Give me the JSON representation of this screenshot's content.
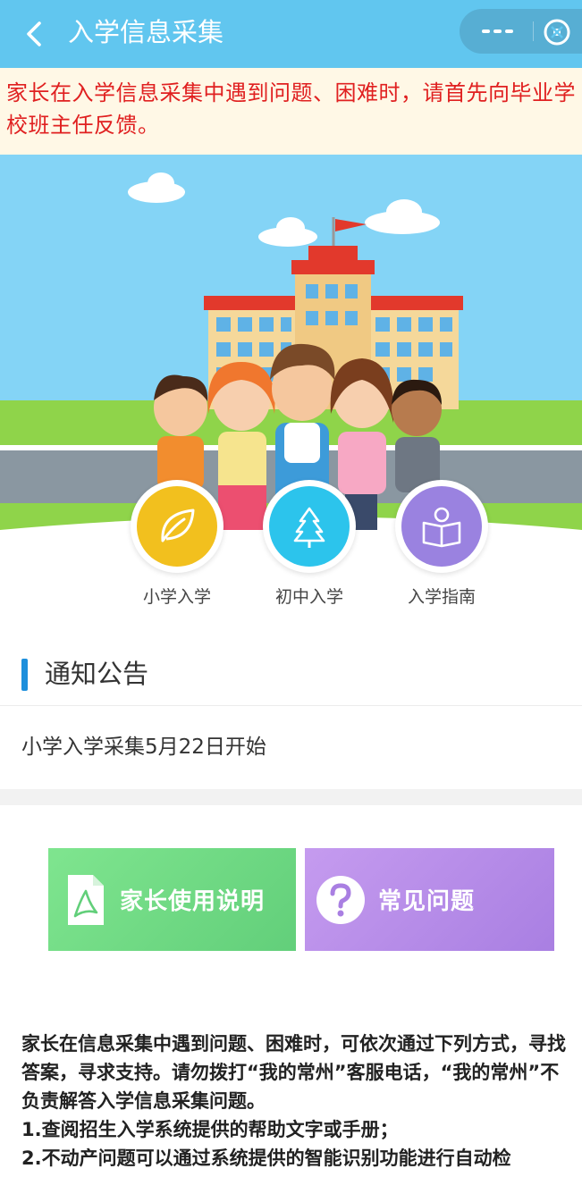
{
  "header": {
    "title": "入学信息采集"
  },
  "warning": {
    "text": "家长在入学信息采集中遇到问题、困难时，请首先向毕业学校班主任反馈。"
  },
  "entries": [
    {
      "label": "小学入学",
      "icon": "leaf-icon",
      "color": "#f2c01e"
    },
    {
      "label": "初中入学",
      "icon": "tree-icon",
      "color": "#2cc4ec"
    },
    {
      "label": "入学指南",
      "icon": "reading-icon",
      "color": "#9a82e0"
    }
  ],
  "notice": {
    "title": "通知公告",
    "items": [
      "小学入学采集5月22日开始"
    ]
  },
  "cards": {
    "guide_label": "家长使用说明",
    "faq_label": "常见问题"
  },
  "help": {
    "lines": [
      "家长在信息采集中遇到问题、困难时，可依次通过下列方式，寻找答案，寻求支持。请勿拨打“我的常州”客服电话，“我的常州”不负责解答入学信息采集问题。",
      "1.查阅招生入学系统提供的帮助文字或手册；",
      "2.不动产问题可以通过系统提供的智能识别功能进行自动检"
    ]
  }
}
